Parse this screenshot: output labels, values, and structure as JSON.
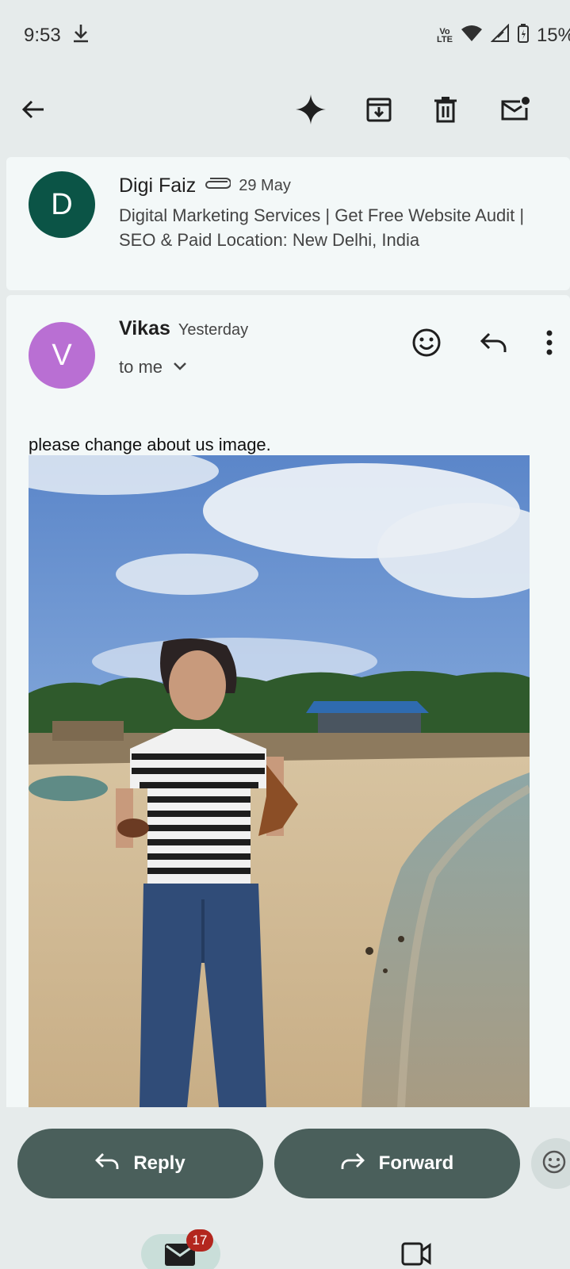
{
  "status_bar": {
    "time": "9:53",
    "network_label_top": "Vo",
    "network_label_bottom": "LTE",
    "battery": "15%"
  },
  "app_bar": {
    "back_icon": "arrow-left-icon",
    "actions": [
      "sparkle-icon",
      "archive-icon",
      "delete-icon",
      "mark-unread-icon"
    ]
  },
  "previous_message": {
    "avatar_letter": "D",
    "avatar_color": "#0b5446",
    "sender": "Digi Faiz",
    "date": "29 May",
    "snippet": "Digital Marketing Services | Get Free Website Audit | SEO & Paid Location: New Delhi, India"
  },
  "current_message": {
    "avatar_letter": "V",
    "avatar_color": "#b96fd3",
    "sender": "Vikas",
    "date": "Yesterday",
    "recipient": "to me",
    "body": "please change about us image."
  },
  "actions": {
    "reply_label": "Reply",
    "forward_label": "Forward"
  },
  "bottom_nav": {
    "mail_badge": "17"
  }
}
